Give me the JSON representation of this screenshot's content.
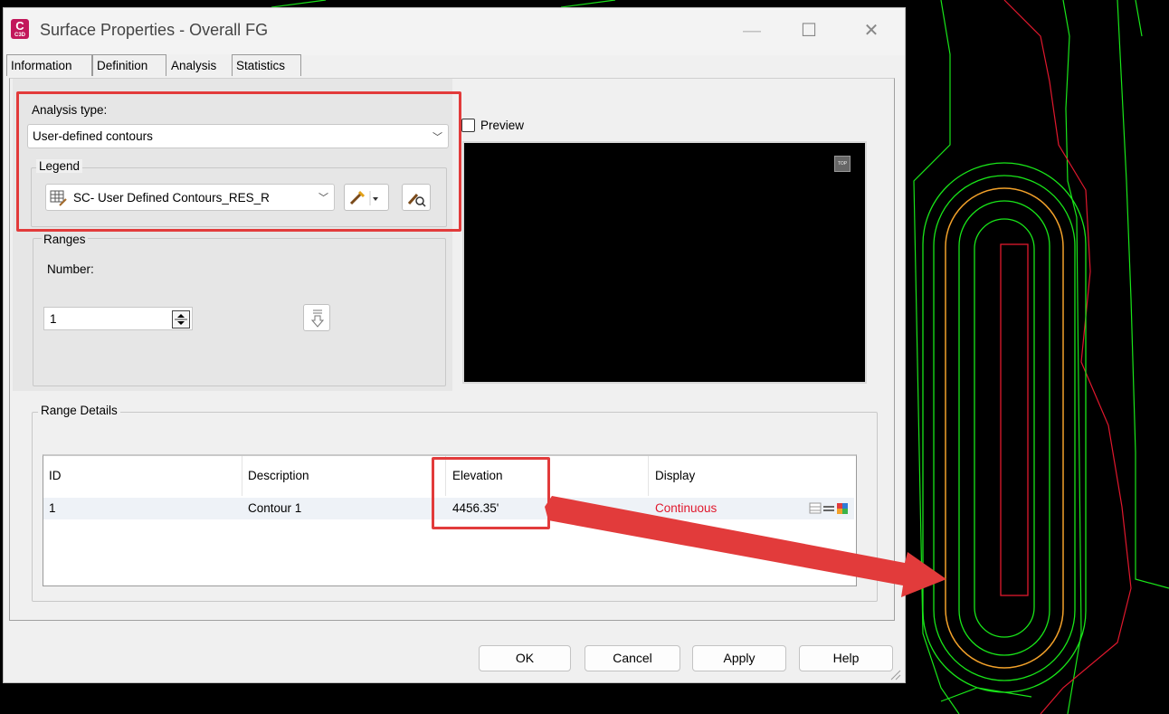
{
  "window": {
    "title": "Surface Properties - Overall FG",
    "app_icon_letter": "C",
    "app_icon_sub": "C3D",
    "maximize_glyph": "☐",
    "close_glyph": "✕"
  },
  "tabs": [
    {
      "label": "Information",
      "active": false
    },
    {
      "label": "Definition",
      "active": false
    },
    {
      "label": "Analysis",
      "active": true
    },
    {
      "label": "Statistics",
      "active": false
    }
  ],
  "analysis": {
    "type_label": "Analysis type:",
    "type_value": "User-defined contours",
    "legend_label": "Legend",
    "legend_value": "SC- User Defined Contours_RES_R"
  },
  "ranges": {
    "group_label": "Ranges",
    "number_label": "Number:",
    "number_value": "1"
  },
  "preview": {
    "label": "Preview",
    "checked": false,
    "corner_badge": "TOP"
  },
  "range_details": {
    "group_label": "Range Details",
    "columns": [
      "ID",
      "Description",
      "Elevation",
      "Display"
    ],
    "rows": [
      {
        "id": "1",
        "description": "Contour 1",
        "elevation": "4456.35'",
        "display": "Continuous"
      }
    ]
  },
  "buttons": {
    "ok": "OK",
    "cancel": "Cancel",
    "apply": "Apply",
    "help": "Help"
  },
  "colors": {
    "highlight": "#e23b3b",
    "display_text": "#e0182d",
    "contour_green": "#19e619",
    "contour_orange": "#f2a12a",
    "contour_red": "#e0182d"
  }
}
